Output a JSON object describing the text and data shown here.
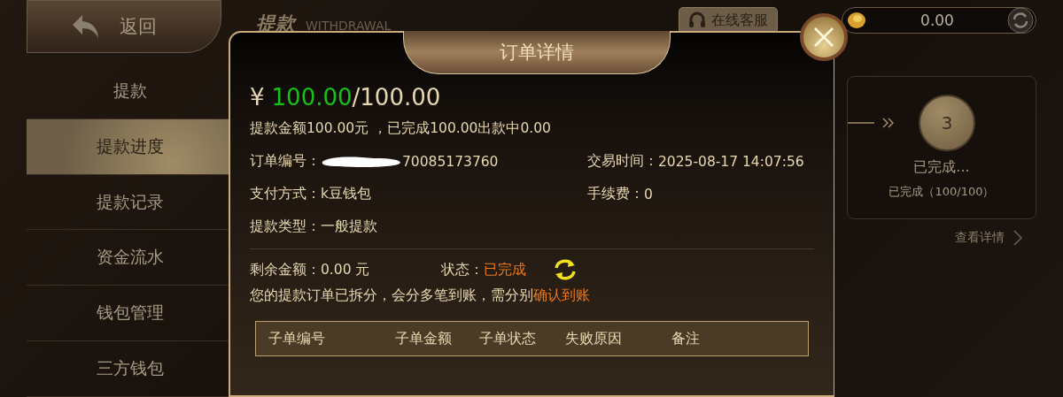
{
  "back_button": {
    "label": "返回"
  },
  "sidebar": {
    "items": [
      {
        "label": "提款",
        "selected": false
      },
      {
        "label": "提款进度",
        "selected": true
      },
      {
        "label": "提款记录",
        "selected": false
      },
      {
        "label": "资金流水",
        "selected": false
      },
      {
        "label": "钱包管理",
        "selected": false
      },
      {
        "label": "三方钱包",
        "selected": false
      }
    ]
  },
  "header": {
    "title": "提款",
    "subtitle": "WITHDRAWAL",
    "support_button": "在线客服"
  },
  "balance": {
    "amount": "0.00"
  },
  "progress_card": {
    "step": "3",
    "status": "已完成...",
    "detail": "已完成（100/100）",
    "link": "查看详情"
  },
  "dialog": {
    "title": "订单详情",
    "currency": "¥",
    "paid": "100.00",
    "total": "/100.00",
    "summary": "提款金额100.00元 ，已完成100.00出款中0.00",
    "fields": [
      {
        "label": "订单编号：",
        "value": "70085173760",
        "redacted": true
      },
      {
        "label": "交易时间：",
        "value": "2025-08-17 14:07:56",
        "redacted": false
      },
      {
        "label": "支付方式：",
        "value": "k豆钱包",
        "redacted": false
      },
      {
        "label": "手续费：",
        "value": "0",
        "redacted": false
      },
      {
        "label": "提款类型：",
        "value": "一般提款",
        "redacted": false
      }
    ],
    "remaining": {
      "label": "剩余金额：",
      "value": "0.00 元"
    },
    "status": {
      "label": "状态：",
      "value": "已完成"
    },
    "notice": "您的提款订单已拆分，会分多笔到账，需分别",
    "notice_link": "确认到账",
    "table": {
      "columns": [
        "子单编号",
        "子单金额",
        "子单状态",
        "失败原因",
        "备注"
      ]
    }
  }
}
